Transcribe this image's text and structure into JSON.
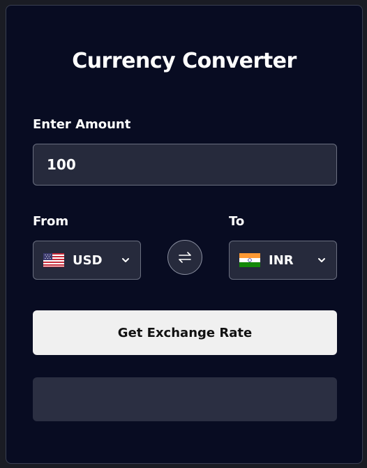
{
  "app": {
    "title": "Currency Converter"
  },
  "amount": {
    "label": "Enter Amount",
    "value": "100"
  },
  "from": {
    "label": "From",
    "code": "USD",
    "flag_icon": "us-flag-icon"
  },
  "to": {
    "label": "To",
    "code": "INR",
    "flag_icon": "india-flag-icon"
  },
  "swap": {
    "icon": "swap-arrows-icon"
  },
  "action": {
    "label": "Get Exchange Rate"
  },
  "result": {
    "text": ""
  },
  "colors": {
    "card_bg": "#080c22",
    "input_bg": "#262a3c",
    "button_bg": "#f0f0f0",
    "result_bg": "#2b2f42"
  }
}
